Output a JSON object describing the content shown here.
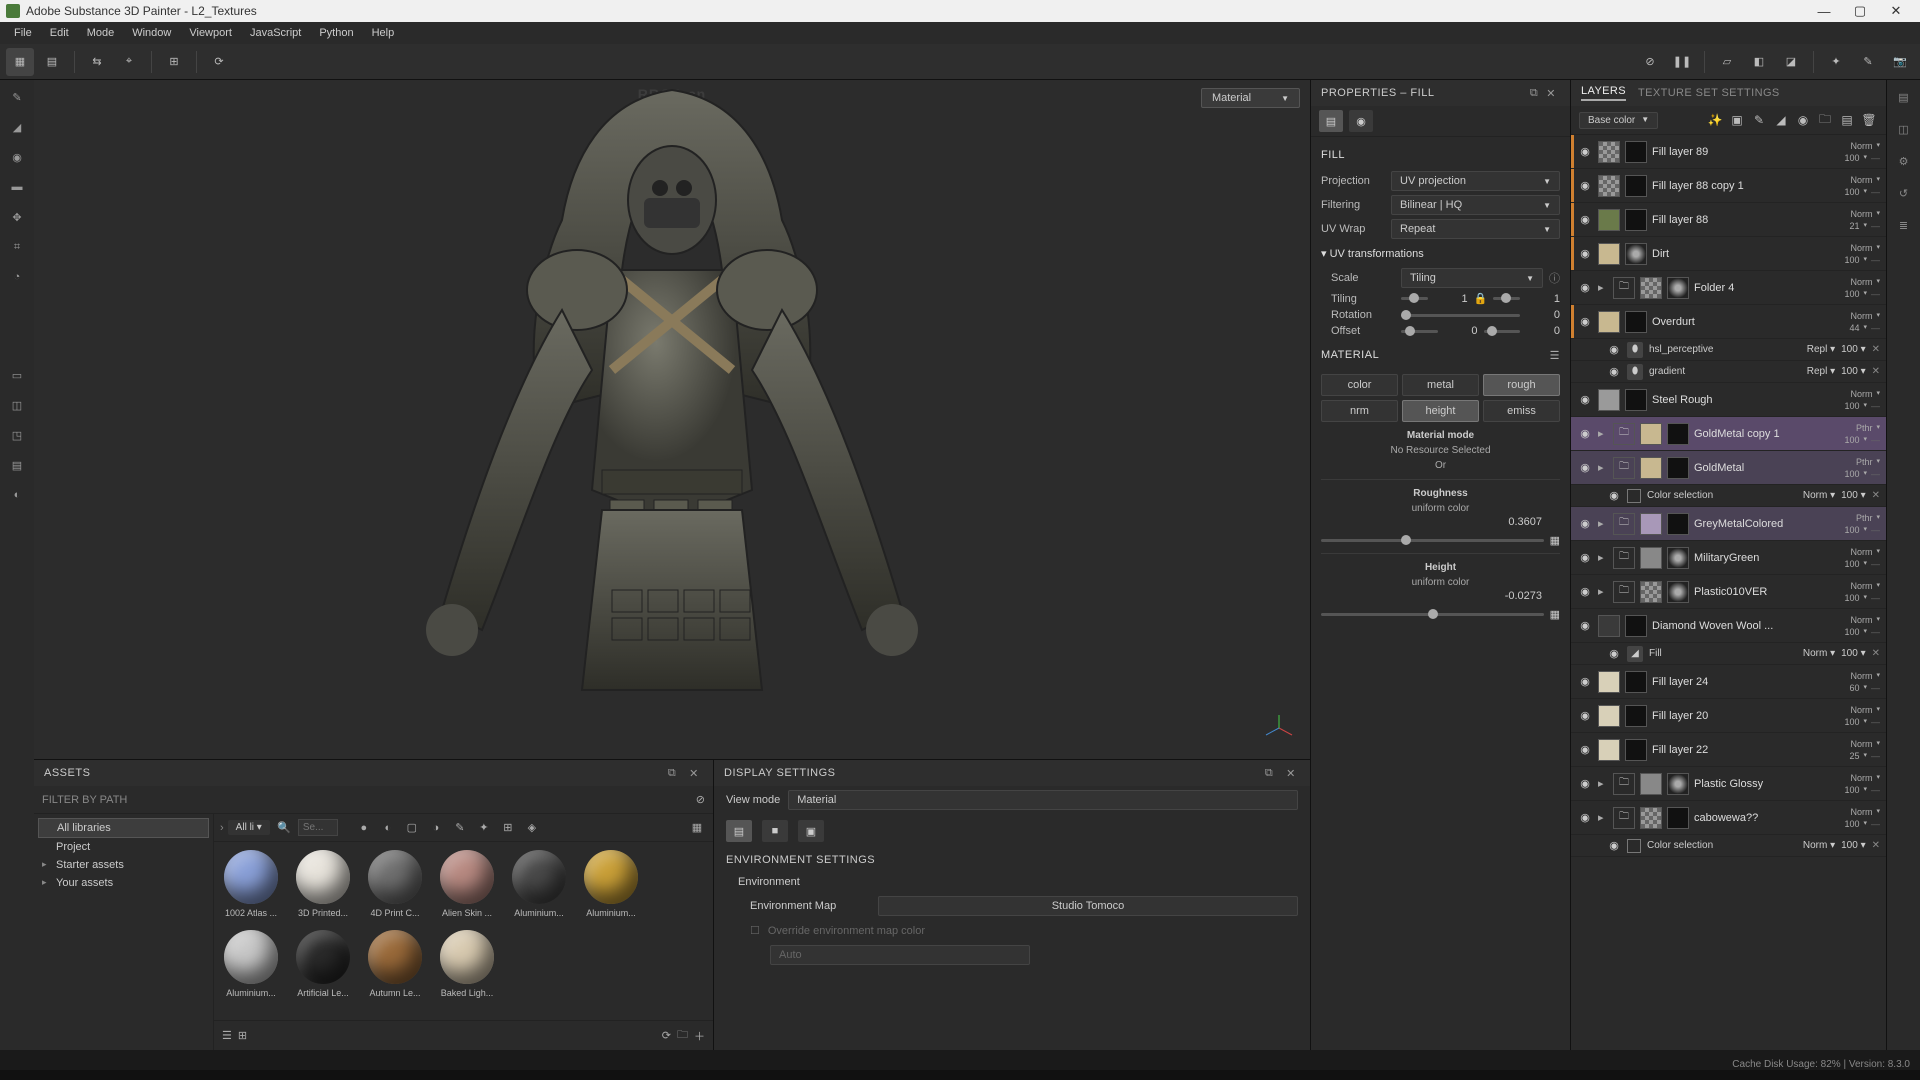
{
  "title_bar": {
    "title": "Adobe Substance 3D Painter - L2_Textures"
  },
  "menu": [
    "File",
    "Edit",
    "Mode",
    "Window",
    "Viewport",
    "JavaScript",
    "Python",
    "Help"
  ],
  "watermark": "RRCG.cn",
  "viewport": {
    "mode_dropdown": "Material",
    "axis": {
      "x": "x",
      "y": "y",
      "z": "z"
    }
  },
  "assets": {
    "title": "ASSETS",
    "filter_label": "FILTER BY PATH",
    "search_placeholder": "Se...",
    "all_lib_label": "All li",
    "tree": [
      {
        "label": "All libraries",
        "selected": true
      },
      {
        "label": "Project"
      },
      {
        "label": "Starter assets",
        "caret": true
      },
      {
        "label": "Your assets",
        "caret": true
      }
    ],
    "items": [
      {
        "label": "1002 Atlas ...",
        "color": "#8aa0d8"
      },
      {
        "label": "3D Printed...",
        "color": "#e8e4dc"
      },
      {
        "label": "4D Print C...",
        "color": "#707070"
      },
      {
        "label": "Alien Skin ...",
        "color": "#b88a82"
      },
      {
        "label": "Aluminium...",
        "color": "#4a4a4a"
      },
      {
        "label": "Aluminium...",
        "color": "#caa038"
      },
      {
        "label": "Aluminium...",
        "color": "#c8c8c8"
      },
      {
        "label": "Artificial Le...",
        "color": "#2a2a2a"
      },
      {
        "label": "Autumn Le...",
        "color": "#9a6a3a"
      },
      {
        "label": "Baked Ligh...",
        "color": "#d8cab0"
      }
    ]
  },
  "display": {
    "title": "DISPLAY SETTINGS",
    "viewmode_label": "View mode",
    "viewmode_value": "Material",
    "env_section": "ENVIRONMENT SETTINGS",
    "env_label": "Environment",
    "envmap_label": "Environment Map",
    "envmap_value": "Studio Tomoco",
    "override_label": "Override environment map color",
    "auto_label": "Auto"
  },
  "properties": {
    "title": "PROPERTIES – FILL",
    "fill_title": "FILL",
    "projection_label": "Projection",
    "projection_value": "UV projection",
    "filtering_label": "Filtering",
    "filtering_value": "Bilinear | HQ",
    "uvwrap_label": "UV Wrap",
    "uvwrap_value": "Repeat",
    "uv_trans_title": "UV transformations",
    "scale_label": "Scale",
    "scale_value": "Tiling",
    "tiling_label": "Tiling",
    "tiling_val_a": "1",
    "tiling_val_b": "1",
    "rotation_label": "Rotation",
    "rotation_val": "0",
    "offset_label": "Offset",
    "offset_a": "0",
    "offset_b": "0",
    "material_title": "MATERIAL",
    "channels": [
      {
        "label": "color",
        "on": false
      },
      {
        "label": "metal",
        "on": false
      },
      {
        "label": "rough",
        "on": true
      },
      {
        "label": "nrm",
        "on": false
      },
      {
        "label": "height",
        "on": true
      },
      {
        "label": "emiss",
        "on": false
      }
    ],
    "matmode_title": "Material mode",
    "matmode_value": "No Resource Selected",
    "or_label": "Or",
    "rough_title": "Roughness",
    "rough_sub": "uniform color",
    "rough_val": "0.3607",
    "height_title": "Height",
    "height_sub": "uniform color",
    "height_val": "-0.0273"
  },
  "layers": {
    "tab_layers": "LAYERS",
    "tab_tss": "TEXTURE SET SETTINGS",
    "channel_dd": "Base color",
    "list": [
      {
        "name": "Fill layer 89",
        "blend": "Norm",
        "opacity": "100",
        "thumb": "checker",
        "mask": "black",
        "accent": "orange"
      },
      {
        "name": "Fill layer 88 copy 1",
        "blend": "Norm",
        "opacity": "100",
        "thumb": "checker",
        "mask": "black",
        "accent": "orange"
      },
      {
        "name": "Fill layer 88",
        "blend": "Norm",
        "opacity": "21",
        "thumb": "green",
        "mask": "black",
        "accent": "orange"
      },
      {
        "name": "Dirt",
        "blend": "Norm",
        "opacity": "100",
        "thumb": "tan",
        "mask": "noise",
        "accent": "orange"
      },
      {
        "name": "Folder 4",
        "blend": "Norm",
        "opacity": "100",
        "folder": true,
        "thumb": "checker",
        "mask": "noise"
      },
      {
        "name": "Overdurt",
        "blend": "Norm",
        "opacity": "44",
        "thumb": "tan",
        "mask": "black",
        "accent": "orange",
        "subs": [
          {
            "name": "hsl_perceptive",
            "blend": "Repl",
            "opacity": "100"
          },
          {
            "name": "gradient",
            "blend": "Repl",
            "opacity": "100"
          }
        ]
      },
      {
        "name": "Steel Rough",
        "blend": "Norm",
        "opacity": "100",
        "thumb": "grey",
        "mask": "black"
      },
      {
        "name": "GoldMetal copy 1",
        "blend": "Pthr",
        "opacity": "100",
        "folder": true,
        "thumb": "tan",
        "mask": "black",
        "sel": "sel"
      },
      {
        "name": "GoldMetal",
        "blend": "Pthr",
        "opacity": "100",
        "folder": true,
        "thumb": "tan",
        "mask": "black",
        "sel": "sel-light",
        "subs": [
          {
            "name": "Color selection",
            "blend": "Norm",
            "opacity": "100",
            "box": true
          }
        ]
      },
      {
        "name": "GreyMetalColored",
        "blend": "Pthr",
        "opacity": "100",
        "folder": true,
        "thumb": "lav",
        "mask": "black",
        "sel": "sel-light"
      },
      {
        "name": "MilitaryGreen",
        "blend": "Norm",
        "opacity": "100",
        "folder": true,
        "mask": "noise"
      },
      {
        "name": "Plastic010VER",
        "blend": "Norm",
        "opacity": "100",
        "folder": true,
        "thumb": "checker",
        "mask": "noise"
      },
      {
        "name": "Diamond Woven Wool ...",
        "blend": "Norm",
        "opacity": "100",
        "thumb": "dark",
        "mask": "black",
        "subs": [
          {
            "name": "Fill",
            "blend": "Norm",
            "opacity": "100",
            "fill": true
          }
        ]
      },
      {
        "name": "Fill layer 24",
        "blend": "Norm",
        "opacity": "60",
        "thumb": "beige",
        "mask": "black"
      },
      {
        "name": "Fill layer 20",
        "blend": "Norm",
        "opacity": "100",
        "thumb": "beige",
        "mask": "black"
      },
      {
        "name": "Fill layer 22",
        "blend": "Norm",
        "opacity": "25",
        "thumb": "beige",
        "mask": "black"
      },
      {
        "name": "Plastic Glossy",
        "blend": "Norm",
        "opacity": "100",
        "folder": true,
        "mask": "noise"
      },
      {
        "name": "cabowewa??",
        "blend": "Norm",
        "opacity": "100",
        "folder": true,
        "thumb": "checker",
        "mask": "black",
        "subs": [
          {
            "name": "Color selection",
            "blend": "Norm",
            "opacity": "100",
            "box": true
          }
        ]
      }
    ]
  },
  "status": "Cache Disk Usage:   82% | Version: 8.3.0"
}
